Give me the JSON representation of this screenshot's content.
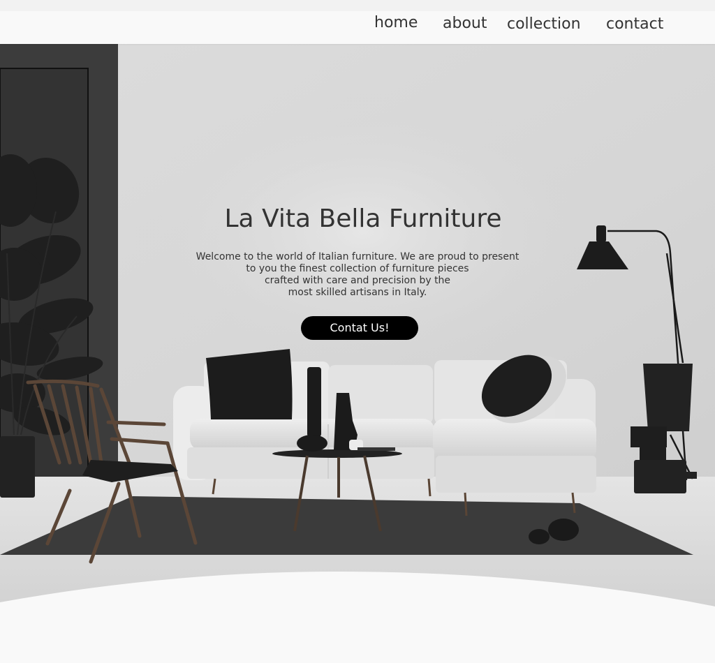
{
  "nav": {
    "items": [
      {
        "label": "home"
      },
      {
        "label": "about"
      },
      {
        "label": "collection"
      },
      {
        "label": "contact"
      }
    ]
  },
  "hero": {
    "title": "La Vita Bella Furniture",
    "text_lines": [
      "Welcome to the world of Italian furniture. We are proud to present",
      "to you the finest collection of furniture pieces",
      "crafted with care and precision by the",
      "most skilled artisans in Italy."
    ],
    "cta_label": "Contat Us!"
  },
  "colors": {
    "background": "#f9f9f9",
    "wall": "#d9d9d9",
    "text": "#333333",
    "button": "#000000",
    "button_text": "#ffffff"
  }
}
